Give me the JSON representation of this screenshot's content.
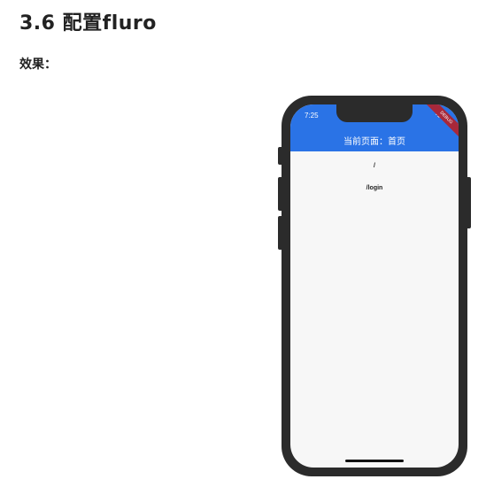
{
  "doc": {
    "heading": "3.6 配置fluro",
    "effect_label": "效果："
  },
  "phone": {
    "status_time": "7:25",
    "debug_label": "DEBUG",
    "app_bar_title": "当前页面：首页",
    "routes": [
      "/",
      "/login"
    ],
    "colors": {
      "app_bar": "#2a73e6",
      "frame": "#2b2b2b",
      "screen": "#f7f7f7",
      "debug_ribbon": "#a8283a"
    }
  }
}
